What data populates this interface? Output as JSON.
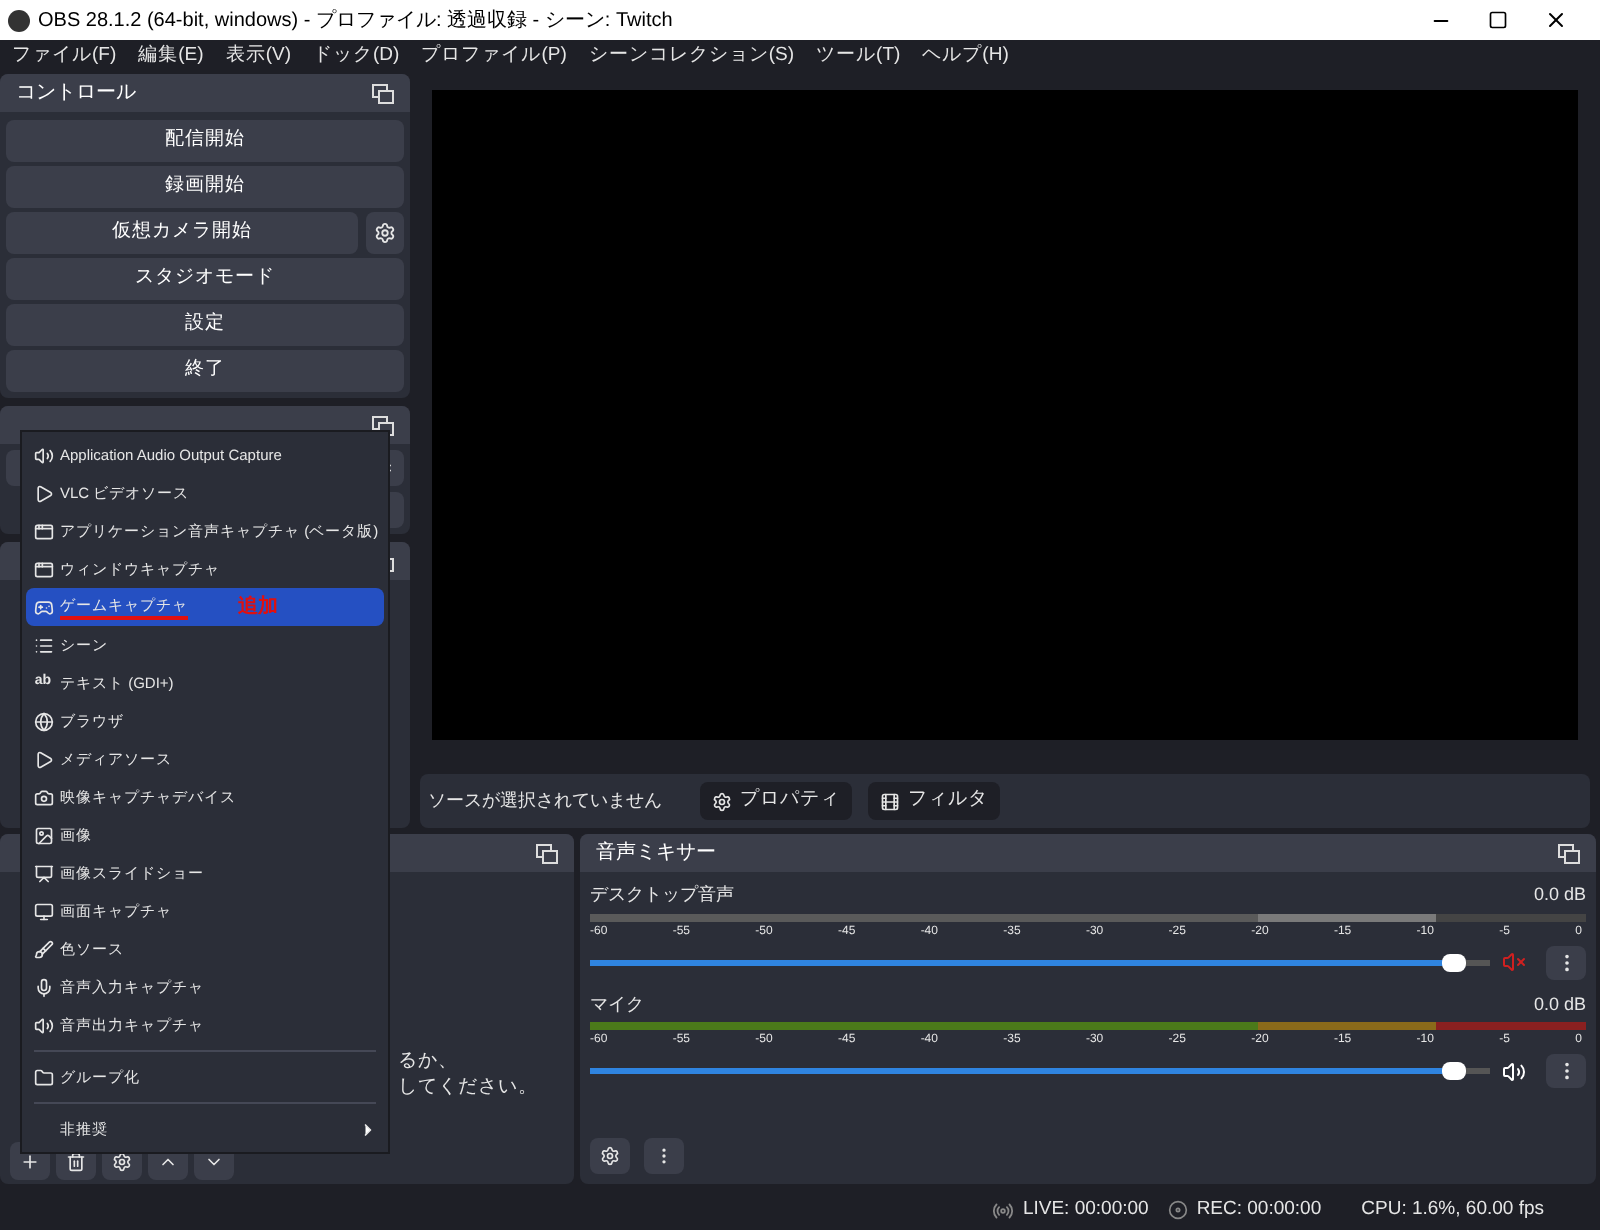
{
  "window": {
    "title": "OBS 28.1.2 (64-bit, windows) - プロファイル: 透過収録 - シーン: Twitch"
  },
  "menubar": [
    "ファイル(F)",
    "編集(E)",
    "表示(V)",
    "ドック(D)",
    "プロファイル(P)",
    "シーンコレクション(S)",
    "ツール(T)",
    "ヘルプ(H)"
  ],
  "controls": {
    "title": "コントロール",
    "buttons": [
      {
        "label": "配信開始",
        "settings": false
      },
      {
        "label": "録画開始",
        "settings": false
      },
      {
        "label": "仮想カメラ開始",
        "settings": true
      },
      {
        "label": "スタジオモード",
        "settings": false
      },
      {
        "label": "設定",
        "settings": false
      },
      {
        "label": "終了",
        "settings": false
      }
    ]
  },
  "sources_panel": {
    "message_lines": [
      "るか、",
      "してください。"
    ]
  },
  "source_bar": {
    "message": "ソースが選択されていません",
    "buttons": [
      "プロパティ",
      "フィルタ"
    ]
  },
  "context_menu": {
    "items": [
      {
        "kind": "item",
        "label": "Application Audio Output Capture",
        "selected": false
      },
      {
        "kind": "item",
        "label": "VLC ビデオソース",
        "selected": false
      },
      {
        "kind": "item",
        "label": "アプリケーション音声キャプチャ (ベータ版)",
        "selected": false
      },
      {
        "kind": "item",
        "label": "ウィンドウキャプチャ",
        "selected": false
      },
      {
        "kind": "item",
        "label": "ゲームキャプチャ",
        "selected": true,
        "annotation": "追加"
      },
      {
        "kind": "item",
        "label": "シーン",
        "selected": false
      },
      {
        "kind": "item",
        "label": "テキスト (GDI+)",
        "selected": false,
        "icon_text": "ab"
      },
      {
        "kind": "item",
        "label": "ブラウザ",
        "selected": false
      },
      {
        "kind": "item",
        "label": "メディアソース",
        "selected": false
      },
      {
        "kind": "item",
        "label": "映像キャプチャデバイス",
        "selected": false
      },
      {
        "kind": "item",
        "label": "画像",
        "selected": false
      },
      {
        "kind": "item",
        "label": "画像スライドショー",
        "selected": false
      },
      {
        "kind": "item",
        "label": "画面キャプチャ",
        "selected": false
      },
      {
        "kind": "item",
        "label": "色ソース",
        "selected": false
      },
      {
        "kind": "item",
        "label": "音声入力キャプチャ",
        "selected": false
      },
      {
        "kind": "item",
        "label": "音声出力キャプチャ",
        "selected": false
      },
      {
        "kind": "separator"
      },
      {
        "kind": "item",
        "label": "グループ化",
        "selected": false
      },
      {
        "kind": "separator"
      },
      {
        "kind": "submenu",
        "label": "非推奨",
        "selected": false
      }
    ]
  },
  "mixer": {
    "title": "音声ミキサー",
    "channels": [
      {
        "name": "デスクトップ音声",
        "reading": "0.0 dB",
        "muted": true,
        "level": 0.96,
        "scale": [
          "-60",
          "-55",
          "-50",
          "-45",
          "-40",
          "-35",
          "-30",
          "-25",
          "-20",
          "-15",
          "-10",
          "-5",
          "0"
        ]
      },
      {
        "name": "マイク",
        "reading": "0.0 dB",
        "muted": false,
        "level": 0.96,
        "scale": [
          "-60",
          "-55",
          "-50",
          "-45",
          "-40",
          "-35",
          "-30",
          "-25",
          "-20",
          "-15",
          "-10",
          "-5",
          "0"
        ]
      }
    ]
  },
  "status_bar": {
    "live": "LIVE: 00:00:00",
    "rec": "REC: 00:00:00",
    "cpu": "CPU: 1.6%, 60.00 fps"
  }
}
